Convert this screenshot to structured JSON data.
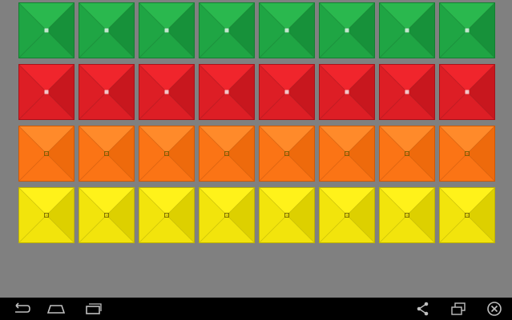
{
  "board": {
    "rows": [
      {
        "color_name": "green",
        "light": "#2ab84e",
        "mid": "#1fa544",
        "dark": "#17913a",
        "edge": "#138030"
      },
      {
        "color_name": "red",
        "light": "#f0252c",
        "mid": "#dd1e25",
        "dark": "#c8171e",
        "edge": "#a8121a"
      },
      {
        "color_name": "orange",
        "light": "#ff8a2a",
        "mid": "#fb7415",
        "dark": "#ee6a0c",
        "edge": "#cf5805"
      },
      {
        "color_name": "yellow",
        "light": "#fff21a",
        "mid": "#f2e40c",
        "dark": "#ddd000",
        "edge": "#bfb400"
      }
    ],
    "columns": 8
  },
  "navbar": {
    "icons": [
      "back-icon",
      "home-icon",
      "recent-apps-icon",
      "share-icon",
      "window-icon",
      "close-icon"
    ]
  }
}
